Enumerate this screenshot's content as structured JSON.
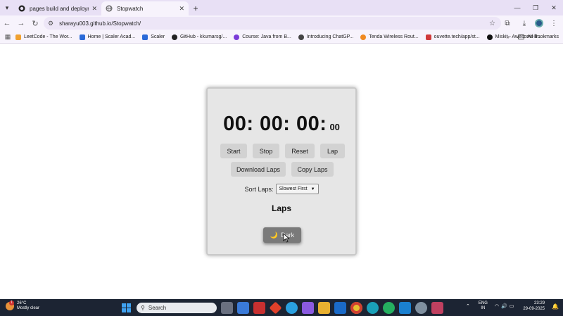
{
  "browser": {
    "tabs": [
      {
        "title": "pages build and deployment · s",
        "active": false
      },
      {
        "title": "Stopwatch",
        "active": true
      }
    ],
    "new_tab": "+",
    "url": "sharayu003.github.io/Stopwatch/",
    "bookmarks": [
      {
        "label": "LeetCode - The Wor...",
        "color": "#f0a030"
      },
      {
        "label": "Home | Scaler Acad...",
        "color": "#2a6ad8"
      },
      {
        "label": "Scaler",
        "color": "#2a6ad8"
      },
      {
        "label": "GitHub - kkumarsg/...",
        "color": "#222222"
      },
      {
        "label": "Course: Java from B...",
        "color": "#7a3ad8"
      },
      {
        "label": "Introducing ChatGP...",
        "color": "#444444"
      },
      {
        "label": "Tenda Wireless Rout...",
        "color": "#f08a20"
      },
      {
        "label": "ouvette.tech/app/st...",
        "color": "#d03a3a"
      },
      {
        "label": "Miskit - Awesome fr...",
        "color": "#111111"
      }
    ],
    "all_bookmarks": "All Bookmarks"
  },
  "stopwatch": {
    "time_main": "00: 00: 00:",
    "time_ms": "00",
    "buttons": {
      "start": "Start",
      "stop": "Stop",
      "reset": "Reset",
      "lap": "Lap",
      "download": "Download Laps",
      "copy": "Copy Laps"
    },
    "sort_label": "Sort Laps:",
    "sort_selected": "Slowest First",
    "laps_title": "Laps",
    "dark_toggle": "Dark",
    "dark_icon": "🌙"
  },
  "taskbar": {
    "weather_temp": "26°C",
    "weather_desc": "Mostly clear",
    "weather_badge": "1",
    "search_placeholder": "Search",
    "lang_line1": "ENG",
    "lang_line2": "IN",
    "time": "23:29",
    "date": "29-09-2025"
  },
  "colors": {
    "card_bg": "#e6e6e6",
    "button_bg": "#d2d2d2",
    "dark_button_bg": "#7a7a7a",
    "taskbar_bg": "#1c2433"
  }
}
